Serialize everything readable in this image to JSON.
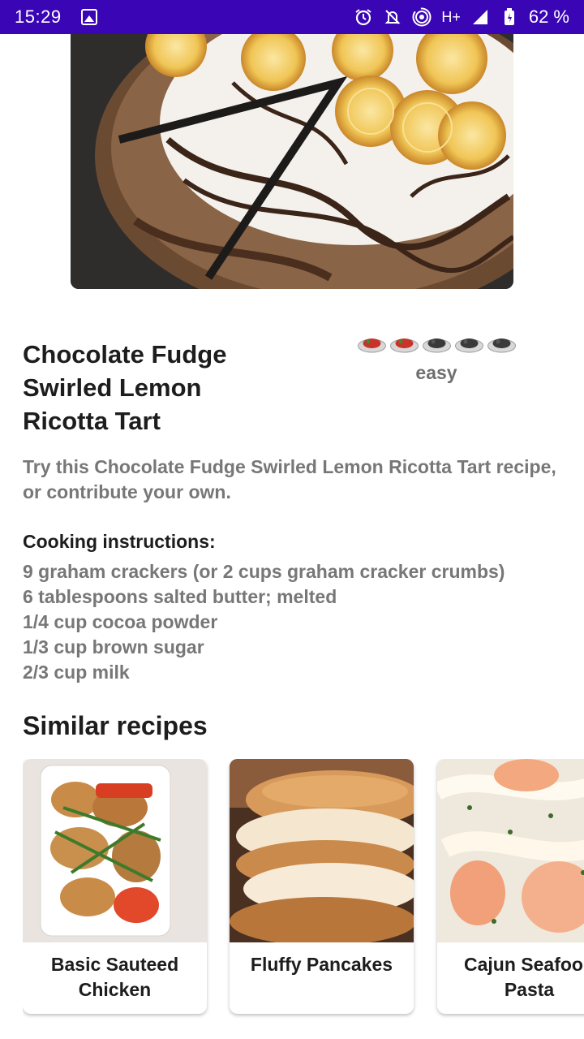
{
  "status_bar": {
    "time": "15:29",
    "network": "H+",
    "battery": "62 %",
    "icons": [
      "image-icon",
      "alarm-icon",
      "silent-icon",
      "hotspot-icon",
      "signal-icon",
      "battery-icon"
    ]
  },
  "recipe": {
    "title": "Chocolate Fudge Swirled Lemon Ricotta Tart",
    "difficulty_label": "easy",
    "difficulty_level": 2,
    "difficulty_max": 5,
    "description": "Try this Chocolate Fudge Swirled Lemon Ricotta Tart recipe, or contribute your own.",
    "instructions_heading": "Cooking instructions:",
    "ingredients": [
      "9 graham crackers (or 2 cups graham cracker crumbs)",
      "6 tablespoons salted butter; melted",
      "1/4 cup cocoa powder",
      "1/3 cup brown sugar",
      "2/3 cup milk"
    ]
  },
  "similar": {
    "heading": "Similar recipes",
    "cards": [
      {
        "title": "Basic Sauteed Chicken"
      },
      {
        "title": "Fluffy Pancakes"
      },
      {
        "title": "Cajun Seafood Pasta"
      }
    ]
  },
  "colors": {
    "status_bar": "#3a06b5",
    "title_text": "#1d1d1d",
    "secondary_text": "#777777"
  }
}
